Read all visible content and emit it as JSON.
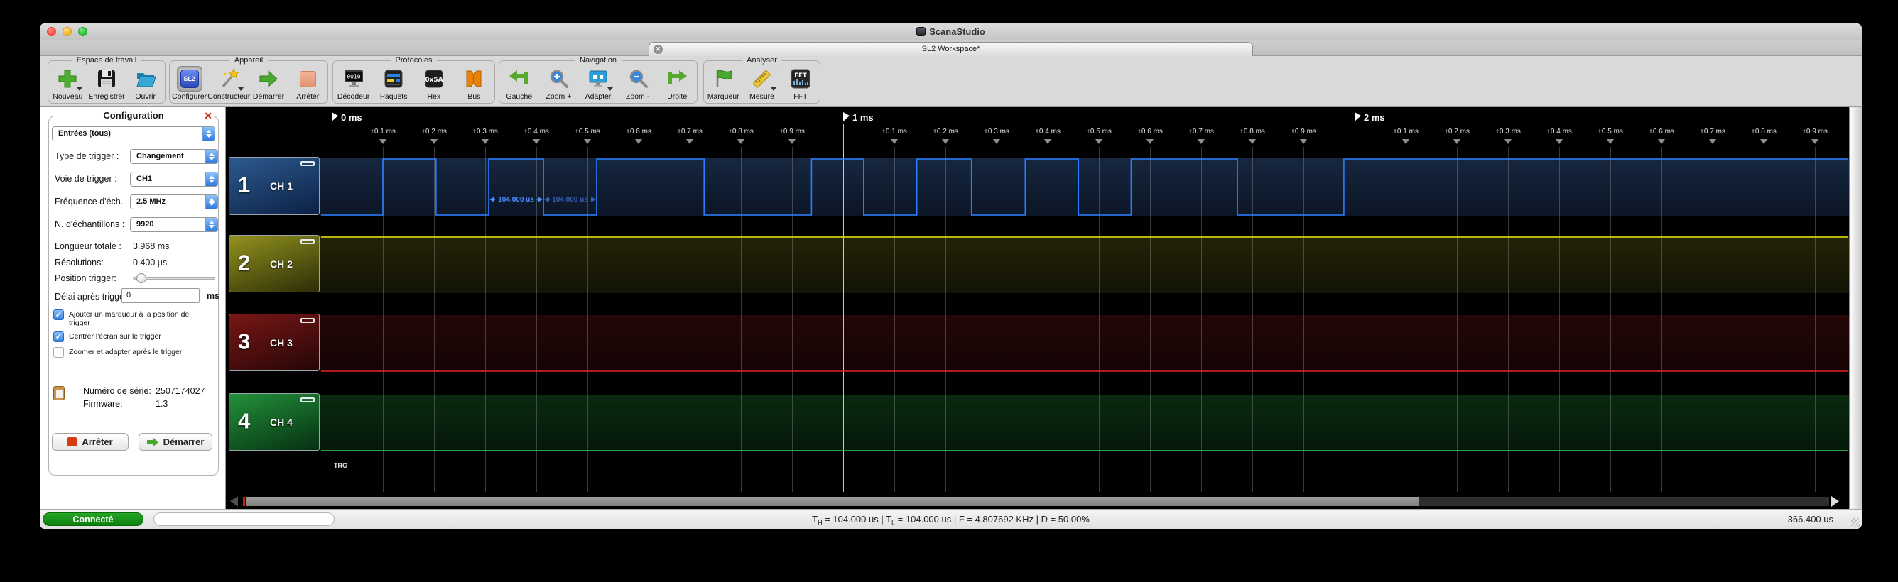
{
  "titlebar": {
    "title": "ScanaStudio"
  },
  "tab": {
    "label": "SL2 Workspace*",
    "close_glyph": "✕"
  },
  "toolbar": {
    "groups": [
      {
        "label": "Espace de travail",
        "buttons": [
          {
            "label": "Nouveau",
            "icon": "new-plus-icon",
            "dropdown": true
          },
          {
            "label": "Enregistrer",
            "icon": "save-floppy-icon"
          },
          {
            "label": "Ouvrir",
            "icon": "open-folder-icon"
          }
        ]
      },
      {
        "label": "Appareil",
        "buttons": [
          {
            "label": "Configurer",
            "icon": "device-sl2-icon",
            "icon_text": "SL2",
            "selected": true
          },
          {
            "label": "Constructeur",
            "icon": "wizard-wand-icon",
            "dropdown": true
          },
          {
            "label": "Démarrer",
            "icon": "start-arrow-icon"
          },
          {
            "label": "Arrêter",
            "icon": "stop-square-icon"
          }
        ]
      },
      {
        "label": "Protocoles",
        "buttons": [
          {
            "label": "Décodeur",
            "icon": "decoder-screen-icon",
            "icon_text": "0010"
          },
          {
            "label": "Paquets",
            "icon": "packets-icon"
          },
          {
            "label": "Hex",
            "icon": "hex-icon",
            "icon_text": "0x5A"
          },
          {
            "label": "Bus",
            "icon": "bus-icon"
          }
        ]
      },
      {
        "label": "Navigation",
        "buttons": [
          {
            "label": "Gauche",
            "icon": "nav-left-icon"
          },
          {
            "label": "Zoom +",
            "icon": "zoom-in-icon"
          },
          {
            "label": "Adapter",
            "icon": "fit-screen-icon",
            "dropdown": true
          },
          {
            "label": "Zoom -",
            "icon": "zoom-out-icon"
          },
          {
            "label": "Droite",
            "icon": "nav-right-icon"
          }
        ]
      },
      {
        "label": "Analyser",
        "buttons": [
          {
            "label": "Marqueur",
            "icon": "marker-flag-icon"
          },
          {
            "label": "Mesure",
            "icon": "measure-ruler-icon",
            "dropdown": true
          },
          {
            "label": "FFT",
            "icon": "fft-icon",
            "icon_text": "FFT"
          }
        ]
      }
    ]
  },
  "config": {
    "title": "Configuration",
    "scope_select": {
      "value": "Entrées (tous)"
    },
    "rows": [
      {
        "label": "Type de trigger :",
        "value": "Changement"
      },
      {
        "label": "Voie de trigger :",
        "value": "CH1"
      },
      {
        "label": "Fréquence d'éch.",
        "value": "2.5 MHz"
      },
      {
        "label": "N. d'échantillons :",
        "value": "9920"
      }
    ],
    "stats": [
      {
        "label": "Longueur totale :",
        "value": "3.968 ms"
      },
      {
        "label": "Résolutions:",
        "value": "0.400 µs"
      }
    ],
    "slider_label": "Position trigger:",
    "delay": {
      "label": "Délai après trigge",
      "value": "0",
      "unit": "ms"
    },
    "checkboxes": [
      {
        "label": "Ajouter un marqueur à la position de trigger",
        "checked": true
      },
      {
        "label": "Centrer l'écran sur le trigger",
        "checked": true
      },
      {
        "label": "Zoomer et adapter après le trigger",
        "checked": false
      }
    ],
    "device": {
      "serial_label": "Numéro de série:",
      "serial": "2507174027",
      "fw_label": "Firmware:",
      "fw": "1.3"
    },
    "stop_btn": "Arrêter",
    "start_btn": "Démarrer"
  },
  "wave": {
    "ruler": {
      "majors": [
        {
          "t": 0,
          "label": "0 ms",
          "trigger": true
        },
        {
          "t": 1,
          "label": "1 ms"
        },
        {
          "t": 2,
          "label": "2 ms"
        }
      ],
      "minor_labels": [
        "+0.1 ms",
        "+0.2 ms",
        "+0.3 ms",
        "+0.4 ms",
        "+0.5 ms",
        "+0.6 ms",
        "+0.7 ms",
        "+0.8 ms",
        "+0.9 ms"
      ],
      "sections": 3
    },
    "trigger_label": "TRG",
    "channels": [
      {
        "num": "1",
        "label": "CH 1",
        "color": "#2e7bff",
        "band_grad": [
          "#16273f",
          "#0b1626"
        ],
        "box_grad": [
          "#2c5a8e",
          "#0c2145"
        ],
        "signal": {
          "initial": 0,
          "edges_ms": [
            0.1,
            0.204,
            0.307,
            0.414,
            0.518,
            0.728,
            0.938,
            1.04,
            1.144,
            1.251,
            1.356,
            1.46,
            1.563,
            1.771,
            1.979
          ]
        }
      },
      {
        "num": "2",
        "label": "CH 2",
        "color": "#e6e600",
        "band_grad": [
          "#232308",
          "#141405"
        ],
        "box_grad": [
          "#92921e",
          "#2d2d08"
        ],
        "signal": {
          "constant": 1
        }
      },
      {
        "num": "3",
        "label": "CH 3",
        "color": "#e62222",
        "band_grad": [
          "#240707",
          "#140404"
        ],
        "box_grad": [
          "#7a1616",
          "#250606"
        ],
        "signal": {
          "constant": 0
        }
      },
      {
        "num": "4",
        "label": "CH 4",
        "color": "#2ed245",
        "band_grad": [
          "#0a2a0e",
          "#05180a"
        ],
        "box_grad": [
          "#22913a",
          "#063012"
        ],
        "signal": {
          "constant": 0
        }
      }
    ],
    "measurements": [
      {
        "text": "104.000 us",
        "from_ms": 0.307,
        "to_ms": 0.414,
        "strong": true
      },
      {
        "text": "104.000 us",
        "from_ms": 0.414,
        "to_ms": 0.518,
        "strong": false
      }
    ]
  },
  "statusbar": {
    "connected": "Connecté",
    "measure": {
      "p1": "T",
      "s1": "H",
      "p2": " = 104.000 us | T",
      "s2": "L",
      "p3": " = 104.000 us | F = 4.807692 KHz | D = 50.00%"
    },
    "right": "366.400 us"
  },
  "chart_data": {
    "type": "line",
    "title": "Logic analyzer digital capture",
    "x_unit": "ms",
    "visible_range_ms": [
      -0.2,
      2.97
    ],
    "sample_info": {
      "total_length": "3.968 ms",
      "resolution": "0.400 µs",
      "sampling_rate": "2.5 MHz",
      "samples": 9920
    },
    "trigger": {
      "position_ms": 0,
      "label": "TRG",
      "type": "Changement",
      "channel": "CH1"
    },
    "channels": [
      {
        "name": "CH 1",
        "kind": "digital",
        "initial_level": 0,
        "edge_times_ms": [
          0.1,
          0.204,
          0.307,
          0.414,
          0.518,
          0.728,
          0.938,
          1.04,
          1.144,
          1.251,
          1.356,
          1.46,
          1.563,
          1.771,
          1.979
        ],
        "final_level": 1,
        "measured": {
          "t_high_us": 104.0,
          "t_low_us": 104.0,
          "frequency_khz": 4.807692,
          "duty_pct": 50.0
        }
      },
      {
        "name": "CH 2",
        "kind": "digital",
        "constant_level": 1
      },
      {
        "name": "CH 3",
        "kind": "digital",
        "constant_level": 0
      },
      {
        "name": "CH 4",
        "kind": "digital",
        "constant_level": 0
      }
    ]
  }
}
